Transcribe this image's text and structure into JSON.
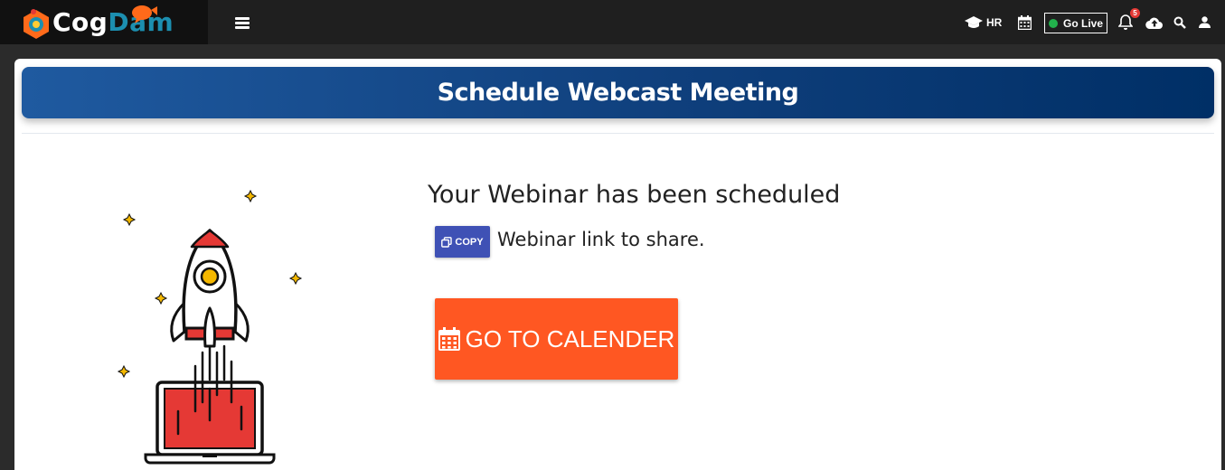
{
  "app": {
    "brand_part1": "Cog",
    "brand_part2": "Dam"
  },
  "topbar": {
    "menu_icon": "hamburger-icon",
    "hr_label": "HR",
    "go_live_label": "Go Live",
    "notification_count": "5",
    "icons": [
      "graduation-cap-icon",
      "calendar-icon",
      "bell-icon",
      "cloud-upload-icon",
      "search-icon",
      "user-icon"
    ]
  },
  "page": {
    "title": "Schedule Webcast Meeting",
    "status_message": "Your Webinar has been scheduled",
    "copy_label": "COPY",
    "share_text": "Webinar link to share.",
    "calendar_button_label": "GO TO CALENDER"
  },
  "colors": {
    "banner_start": "#1f5aa0",
    "banner_end": "#002f66",
    "copy_button": "#3f51b5",
    "calendar_button": "#ff5722",
    "live_dot": "#22b14c",
    "badge": "#e53935"
  }
}
